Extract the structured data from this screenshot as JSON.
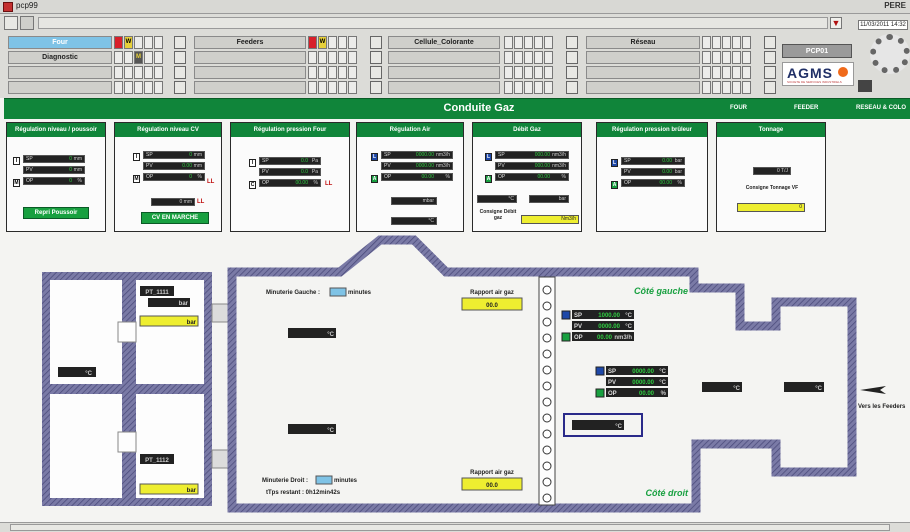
{
  "window": {
    "title": "pcp99",
    "corner_label": "PERE"
  },
  "clock": "11/03/2011 14:32",
  "alarm_rows": [
    {
      "label": "Four",
      "highlight": true
    },
    {
      "label": "Diagnostic",
      "highlight": false
    },
    {
      "label": "Feeders",
      "highlight": false
    },
    {
      "label": "Cellule_Colorante",
      "highlight": false
    },
    {
      "label": "Réseau",
      "highlight": false
    }
  ],
  "badges": {
    "warn": "W",
    "mute": "M"
  },
  "pcp_button": "PCP01",
  "brand": {
    "name": "AGMS",
    "tagline": "SOCIETE DE SERVICES INDUSTRIELS"
  },
  "banner": {
    "title": "Conduite Gaz",
    "nav": [
      "FOUR",
      "FEEDER",
      "RESEAU & COLO"
    ]
  },
  "panels": {
    "p1": {
      "title": "Régulation niveau / poussoir",
      "rows": [
        [
          "SP",
          "0",
          "mm"
        ],
        [
          "PV",
          "0",
          "mm"
        ],
        [
          "OP",
          "0",
          "%"
        ]
      ],
      "button": "Repri Poussoir",
      "i": "I",
      "m": "M"
    },
    "p2": {
      "title": "Régulation niveau CV",
      "rows": [
        [
          "SP",
          "0",
          "mm"
        ],
        [
          "PV",
          "0.00",
          "mm"
        ],
        [
          "OP",
          "0",
          "%"
        ]
      ],
      "value": "0 mm",
      "button": "CV EN MARCHE",
      "ll": "LL",
      "i": "I",
      "m": "M"
    },
    "p3": {
      "title": "Régulation pression Four",
      "rows": [
        [
          "SP",
          "0.0",
          "Pa"
        ],
        [
          "PV",
          "0.0",
          "Pa"
        ],
        [
          "OP",
          "00.00",
          "%"
        ]
      ],
      "ll": "LL",
      "i": "I",
      "c": "C"
    },
    "p4": {
      "title": "Régulation Air",
      "rows": [
        [
          "SP",
          "0000.00",
          "nm3/h"
        ],
        [
          "PV",
          "0000.00",
          "nm3/h"
        ],
        [
          "OP",
          "00.00",
          "%"
        ]
      ],
      "box1": "mbar",
      "box2": "°C",
      "l": "L",
      "a": "A"
    },
    "p5": {
      "title": "Débit Gaz",
      "rows": [
        [
          "SP",
          "000.00",
          "nm3/h"
        ],
        [
          "PV",
          "000.00",
          "nm3/h"
        ],
        [
          "OP",
          "00.00",
          "%"
        ]
      ],
      "box1": "°C",
      "box2": "bar",
      "consigne": "Consigne Débit gaz",
      "consigne_unit": "Nm3/h",
      "l": "L",
      "a": "A"
    },
    "p6": {
      "title": "Régulation pression brûleur",
      "rows": [
        [
          "SP",
          "0.00",
          "bar"
        ],
        [
          "PV",
          "0.00",
          "bar"
        ],
        [
          "OP",
          "00.00",
          "%"
        ]
      ],
      "l": "L",
      "a": "A"
    },
    "p7": {
      "title": "Tonnage",
      "value": "0 T/J",
      "consigne": "Consigne Tonnage VF",
      "consigne_val": "0"
    }
  },
  "diagram": {
    "minuterie_gauche": "Minuterie Gauche :",
    "minuterie_droit": "Minuterie Droit :",
    "minutes": "minutes",
    "tps_restant": "tTps restant : 0h12min42s",
    "rapport_top": "Rapport air gaz",
    "rapport_bottom": "Rapport air gaz",
    "rapport_val": "00.0",
    "cote_gauche": "Côté gauche",
    "cote_droit": "Côté droit",
    "vers_feeders": "Vers les Feeders",
    "pt_top": "PT_1111",
    "pt_bot": "PT_1112",
    "bar_unit": "bar",
    "temp_unit": "°C",
    "left_cluster": [
      [
        "SP",
        "1000.00",
        "°C"
      ],
      [
        "PV",
        "0000.00",
        "°C"
      ],
      [
        "OP",
        "00.00",
        "nm3/h"
      ]
    ],
    "mid_cluster": [
      [
        "SP",
        "0000.00",
        "°C"
      ],
      [
        "PV",
        "0000.00",
        "°C"
      ],
      [
        "OP",
        "00.00",
        "%"
      ]
    ]
  }
}
